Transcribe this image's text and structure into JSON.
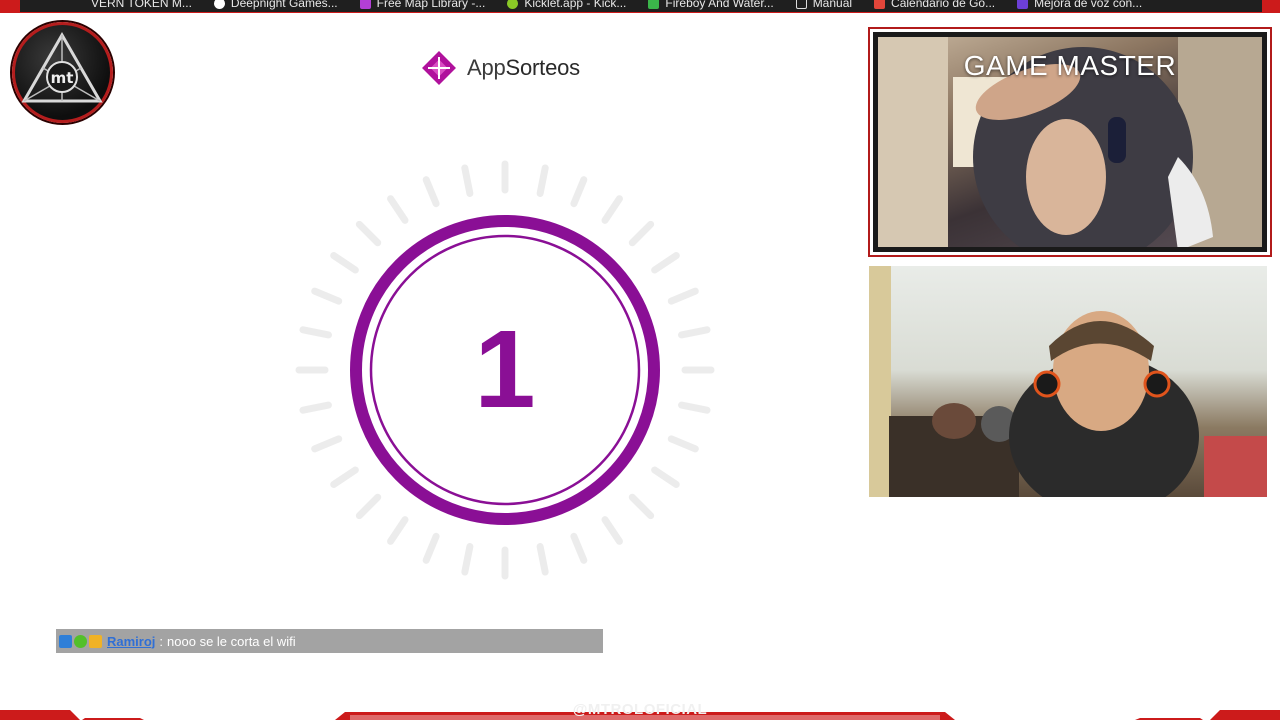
{
  "bookmarks": [
    {
      "label": "VERN TOKEN M...",
      "icon": "token-icon",
      "color": "#e8e8e8"
    },
    {
      "label": "Deepnight Games...",
      "icon": "github-icon",
      "color": "#ffffff"
    },
    {
      "label": "Free Map Library -...",
      "icon": "map-icon",
      "color": "#b33fd6"
    },
    {
      "label": "Kicklet.app - Kick...",
      "icon": "kicklet-icon",
      "color": "#8ac926"
    },
    {
      "label": "Fireboy And Water...",
      "icon": "game-icon",
      "color": "#3bb54a"
    },
    {
      "label": "Manual",
      "icon": "document-icon",
      "color": "#dddddd"
    },
    {
      "label": "Calendario de Go...",
      "icon": "calendar-icon",
      "color": "#e2463a"
    },
    {
      "label": "Mejora de voz con...",
      "icon": "voice-icon",
      "color": "#6c3fd6"
    }
  ],
  "brand": {
    "prefix": "App",
    "suffix": "Sorteos",
    "accent": "#b0119c"
  },
  "countdown": {
    "value": "1",
    "color": "#8a0f95"
  },
  "webcam": {
    "title": "GAME MASTER"
  },
  "chat": {
    "user": "Ramiroj",
    "separator": ":",
    "message": "nooo se le corta el wifi",
    "badges": [
      "verified-badge-icon",
      "star-badge-icon",
      "crown-badge-icon"
    ]
  },
  "watermark": "@MTROLOFICIAL"
}
